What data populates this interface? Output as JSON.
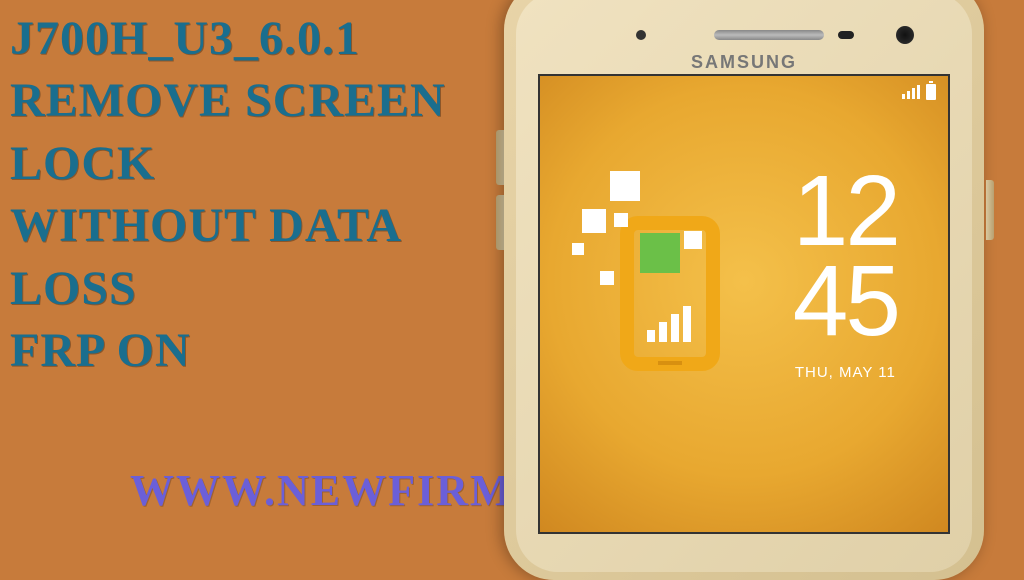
{
  "promo": {
    "line1": "J700H_U3_6.0.1",
    "line2": "REMOVE SCREEN",
    "line3": " LOCK",
    "line4": "WITHOUT DATA",
    "line5": " LOSS",
    "line6": " FRP ON"
  },
  "website": "WWW.NEWFIRMWARES.COM",
  "phone": {
    "brand": "SAMSUNG",
    "clock_hours": "12",
    "clock_minutes": "45",
    "date": "THU, MAY 11"
  }
}
